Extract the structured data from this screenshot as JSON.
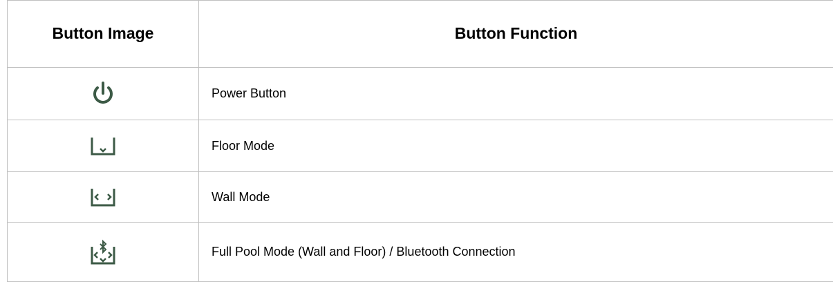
{
  "table": {
    "header": {
      "col1": "Button Image",
      "col2": "Button Function"
    },
    "rows": [
      {
        "icon": "power-icon",
        "function": "Power Button"
      },
      {
        "icon": "floor-mode-icon",
        "function": "Floor Mode"
      },
      {
        "icon": "wall-mode-icon",
        "function": "Wall Mode"
      },
      {
        "icon": "full-pool-mode-icon",
        "function": "Full Pool Mode (Wall and Floor) / Bluetooth Connection"
      }
    ]
  },
  "colors": {
    "icon": "#3c5a46",
    "border": "#bfbfbf"
  }
}
